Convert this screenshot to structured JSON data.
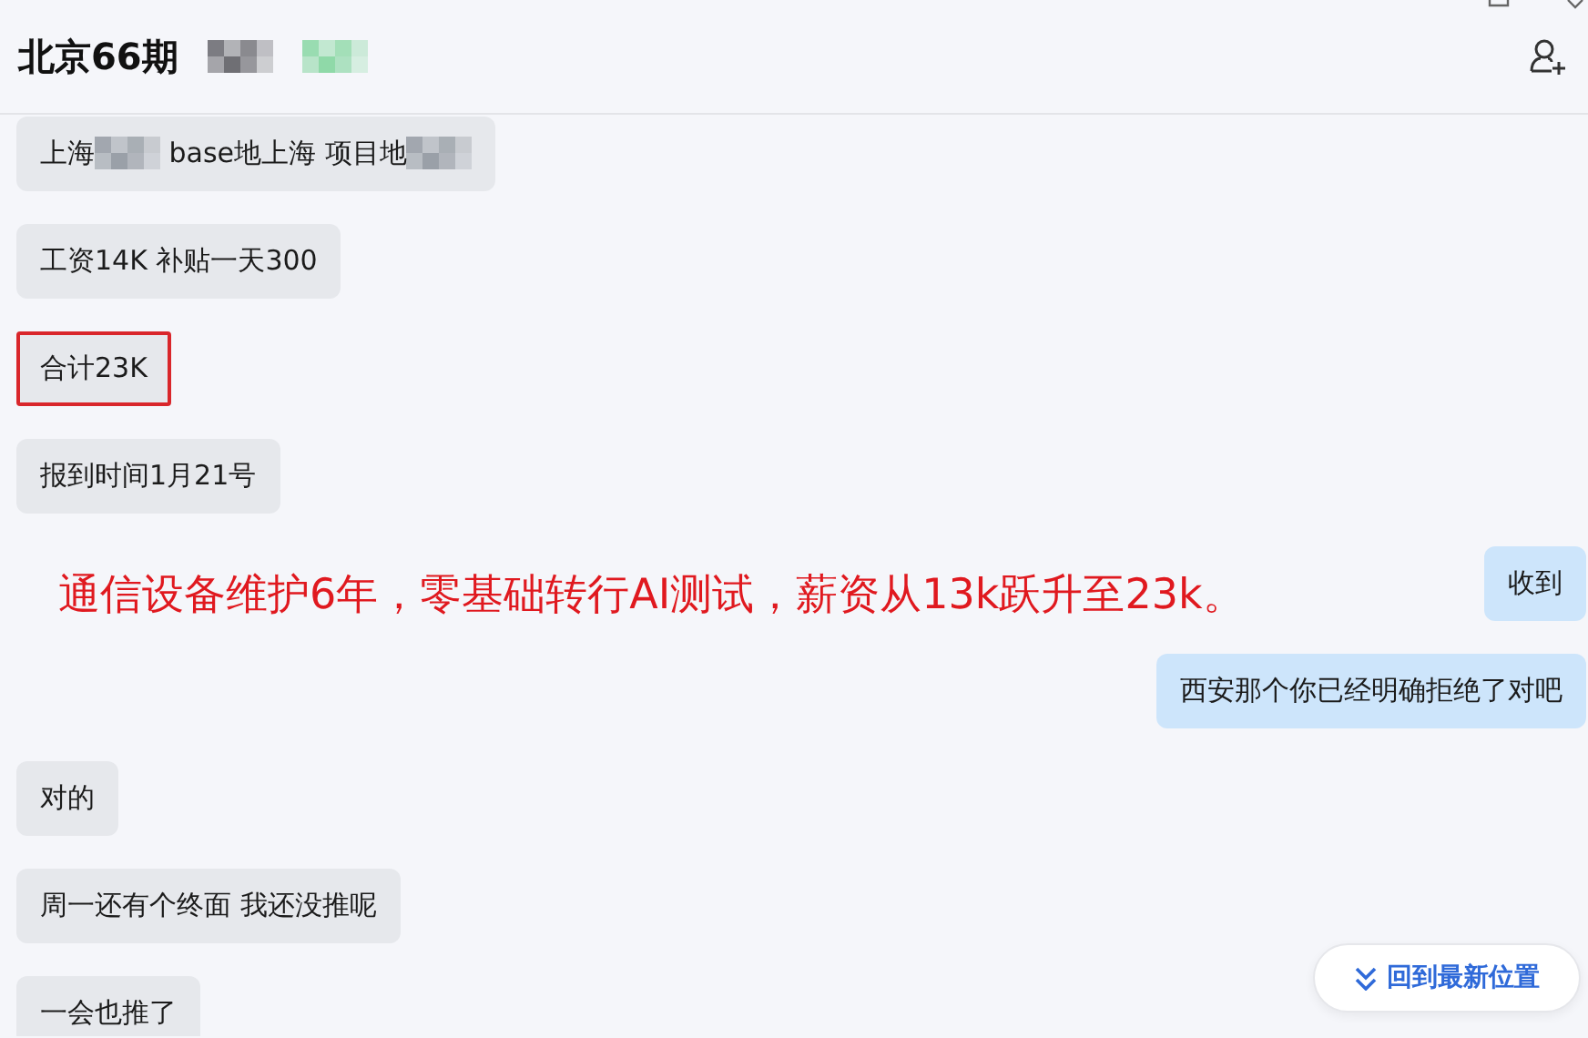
{
  "header": {
    "title": "北京66期",
    "redactions": [
      {
        "color": "#6f6f74"
      },
      {
        "color": "#8fd9a8"
      }
    ]
  },
  "messages": [
    {
      "kind": "incoming",
      "highlighted": false,
      "parts": [
        {
          "kind": "text",
          "text": "上海"
        },
        {
          "kind": "redacted"
        },
        {
          "kind": "text",
          "text": " base地上海 项目地"
        },
        {
          "kind": "redacted"
        }
      ]
    },
    {
      "kind": "incoming",
      "highlighted": false,
      "parts": [
        {
          "kind": "text",
          "text": "工资14K 补贴一天300"
        }
      ]
    },
    {
      "kind": "incoming",
      "highlighted": true,
      "parts": [
        {
          "kind": "text",
          "text": "合计23K"
        }
      ]
    },
    {
      "kind": "incoming",
      "highlighted": false,
      "parts": [
        {
          "kind": "text",
          "text": "报到时间1月21号"
        }
      ]
    },
    {
      "kind": "outgoing",
      "highlighted": false,
      "parts": [
        {
          "kind": "text",
          "text": "收到"
        }
      ]
    },
    {
      "kind": "outgoing",
      "highlighted": false,
      "parts": [
        {
          "kind": "text",
          "text": "西安那个你已经明确拒绝了对吧"
        }
      ]
    },
    {
      "kind": "incoming",
      "highlighted": false,
      "parts": [
        {
          "kind": "text",
          "text": "对的"
        }
      ]
    },
    {
      "kind": "incoming",
      "highlighted": false,
      "parts": [
        {
          "kind": "text",
          "text": "周一还有个终面 我还没推呢"
        }
      ]
    },
    {
      "kind": "incoming",
      "highlighted": false,
      "parts": [
        {
          "kind": "text",
          "text": "一会也推了"
        }
      ]
    }
  ],
  "annotation": "通信设备维护6年，零基础转行AI测试，薪资从13k跃升至23k。",
  "jump_button": "回到最新位置"
}
